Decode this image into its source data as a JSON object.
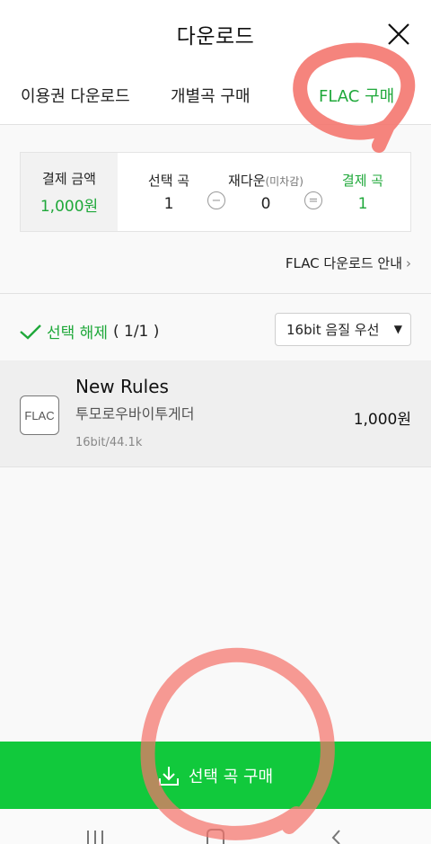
{
  "header": {
    "title": "다운로드"
  },
  "tabs": [
    {
      "label": "이용권 다운로드",
      "active": false
    },
    {
      "label": "개별곡 구매",
      "active": false
    },
    {
      "label": "FLAC 구매",
      "active": true
    }
  ],
  "summary": {
    "payment_label": "결제 금액",
    "payment_value": "1,000원",
    "selected_label": "선택 곡",
    "selected_value": "1",
    "minus_symbol": "−",
    "redownload_label": "재다운",
    "redownload_sub": "(미차감)",
    "redownload_value": "0",
    "equals_symbol": "=",
    "paid_label": "결제 곡",
    "paid_value": "1"
  },
  "info_link": {
    "label": "FLAC 다운로드 안내",
    "chevron": "›"
  },
  "selection": {
    "deselect_label": "선택 해제",
    "count": "( 1/1 )",
    "quality_value": "16bit 음질 우선",
    "quality_arrow": "▼"
  },
  "track": {
    "icon_label": "FLAC",
    "title": "New Rules",
    "artist": "투모로우바이투게더",
    "quality": "16bit/44.1k",
    "price": "1,000원"
  },
  "buy_button": {
    "label": "선택 곡 구매"
  },
  "colors": {
    "accent_green": "#1fa83a",
    "button_green": "#11c93c",
    "annotation_red": "#f4736b"
  },
  "icons": {
    "close": "close-icon",
    "check": "check-icon",
    "download": "download-icon",
    "recent_apps": "recent-apps-icon",
    "home": "home-icon",
    "back": "back-icon"
  }
}
